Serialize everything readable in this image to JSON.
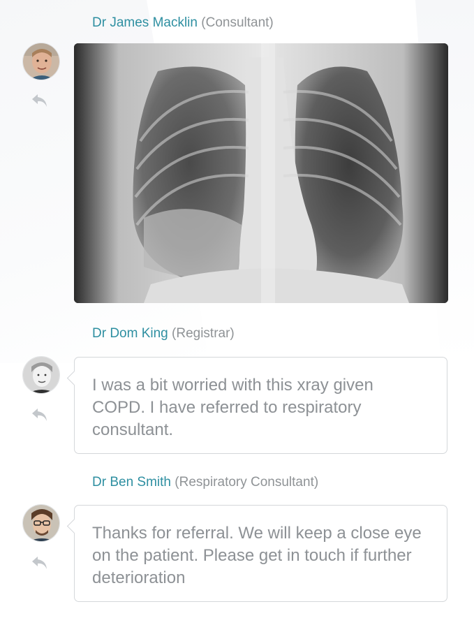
{
  "messages": [
    {
      "sender_name": "Dr James Macklin",
      "sender_role": "(Consultant)",
      "attachment_icon": "chest-xray-image",
      "avatar_icon": "avatar-james-macklin",
      "reply_icon": "reply-icon"
    },
    {
      "sender_name": "Dr Dom King",
      "sender_role": "(Registrar)",
      "text": "I was a bit worried with this xray given COPD. I have referred to respiratory consultant.",
      "avatar_icon": "avatar-dom-king",
      "reply_icon": "reply-icon"
    },
    {
      "sender_name": "Dr Ben Smith",
      "sender_role": "(Respiratory Consultant)",
      "text": "Thanks for referral. We will keep a close eye on the patient. Please get in touch if further deterioration",
      "avatar_icon": "avatar-ben-smith",
      "reply_icon": "reply-icon"
    }
  ],
  "colors": {
    "sender_name": "#2e8fa1",
    "role": "#8f9396",
    "message_text": "#8d9195",
    "bubble_border": "#d4d7da"
  }
}
